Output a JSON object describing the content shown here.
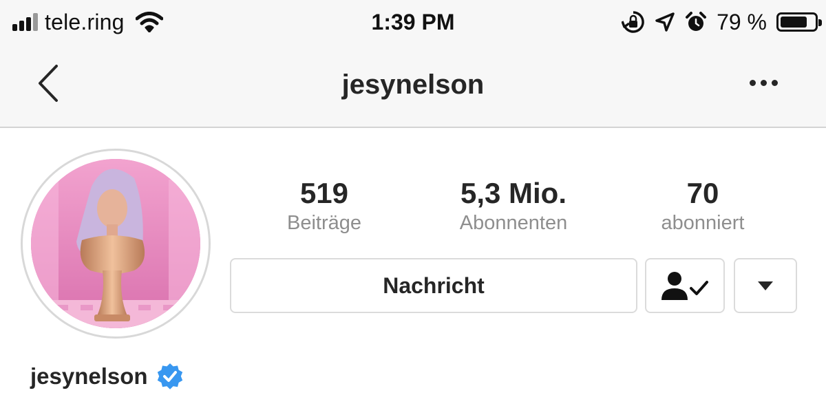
{
  "status_bar": {
    "carrier": "tele.ring",
    "time": "1:39 PM",
    "battery_percent_label": "79 %",
    "battery_level": 0.79,
    "icons": [
      "signal-icon",
      "wifi-icon",
      "orientation-lock-icon",
      "location-arrow-icon",
      "alarm-icon",
      "battery-icon"
    ]
  },
  "nav": {
    "title": "jesynelson",
    "back_icon": "chevron-left-icon",
    "more_icon": "more-horizontal-icon"
  },
  "profile": {
    "username": "jesynelson",
    "verified": true,
    "avatar_colors": {
      "background": "#e58ac0",
      "hair": "#cbb6dc",
      "bust": "#d9a07a"
    }
  },
  "stats": [
    {
      "value": "519",
      "label": "Beiträge"
    },
    {
      "value": "5,3 Mio.",
      "label": "Abonnenten"
    },
    {
      "value": "70",
      "label": "abonniert"
    }
  ],
  "actions": {
    "message_label": "Nachricht",
    "following_icon": "person-check-icon",
    "dropdown_icon": "caret-down-icon"
  },
  "colors": {
    "verified_blue": "#3897f0",
    "text": "#262626",
    "muted": "#8e8e8e",
    "border": "#dbdbdb"
  }
}
